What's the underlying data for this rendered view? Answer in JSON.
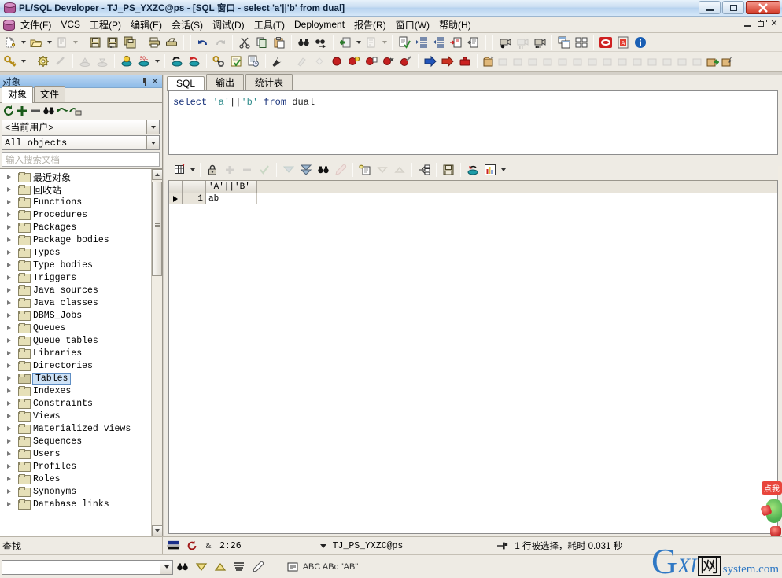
{
  "window": {
    "title": "PL/SQL Developer - TJ_PS_YXZC@ps - [SQL 窗口 - select 'a'||'b' from dual]",
    "app_icon": "database-icon",
    "buttons": {
      "minimize": "minimize-icon",
      "maximize": "maximize-icon",
      "close": "close-icon"
    },
    "mdi_buttons": {
      "minimize": "mdi-minimize-icon",
      "restore": "mdi-restore-icon",
      "close": "mdi-close-icon"
    }
  },
  "menu": {
    "icon": "database-icon",
    "items": [
      {
        "label": "文件(F)",
        "name": "menu-file"
      },
      {
        "label": "VCS",
        "name": "menu-vcs"
      },
      {
        "label": "工程(P)",
        "name": "menu-project"
      },
      {
        "label": "编辑(E)",
        "name": "menu-edit"
      },
      {
        "label": "会话(S)",
        "name": "menu-session"
      },
      {
        "label": "调试(D)",
        "name": "menu-debug"
      },
      {
        "label": "工具(T)",
        "name": "menu-tools"
      },
      {
        "label": "Deployment",
        "name": "menu-deployment"
      },
      {
        "label": "报告(R)",
        "name": "menu-reports"
      },
      {
        "label": "窗口(W)",
        "name": "menu-window"
      },
      {
        "label": "帮助(H)",
        "name": "menu-help"
      }
    ]
  },
  "toolbar_main": {
    "groups": [
      {
        "buttons": [
          {
            "name": "new-icon",
            "glyph": "new",
            "enabled": true,
            "dropdown": true
          },
          {
            "name": "open-icon",
            "glyph": "open",
            "enabled": true,
            "dropdown": true
          },
          {
            "name": "print-preview-icon",
            "glyph": "printpreview",
            "enabled": false,
            "dropdown": true
          }
        ]
      },
      {
        "buttons": [
          {
            "name": "save-icon",
            "glyph": "save",
            "enabled": true
          },
          {
            "name": "save-as-icon",
            "glyph": "saveas",
            "enabled": true
          },
          {
            "name": "save-all-icon",
            "glyph": "saveall",
            "enabled": true
          }
        ]
      },
      {
        "buttons": [
          {
            "name": "print-icon",
            "glyph": "print",
            "enabled": true
          },
          {
            "name": "print-setup-icon",
            "glyph": "printsetup",
            "enabled": true
          }
        ]
      },
      {
        "buttons": [
          {
            "name": "undo-icon",
            "glyph": "undo",
            "enabled": true
          },
          {
            "name": "redo-icon",
            "glyph": "redo",
            "enabled": false
          }
        ]
      },
      {
        "buttons": [
          {
            "name": "cut-icon",
            "glyph": "cut",
            "enabled": true
          },
          {
            "name": "copy-icon",
            "glyph": "copy",
            "enabled": true
          },
          {
            "name": "paste-icon",
            "glyph": "paste",
            "enabled": true
          }
        ]
      },
      {
        "buttons": [
          {
            "name": "find-icon",
            "glyph": "find",
            "enabled": true
          },
          {
            "name": "find-next-icon",
            "glyph": "findnext",
            "enabled": true
          }
        ]
      },
      {
        "buttons": [
          {
            "name": "back-icon",
            "glyph": "back",
            "enabled": true,
            "dropdown": true
          },
          {
            "name": "forward-icon",
            "glyph": "forward",
            "enabled": false,
            "dropdown": true
          }
        ]
      },
      {
        "buttons": [
          {
            "name": "syntax-check-icon",
            "glyph": "syntaxcheck",
            "enabled": true
          },
          {
            "name": "indent-icon",
            "glyph": "indent",
            "enabled": true
          },
          {
            "name": "outdent-icon",
            "glyph": "outdent",
            "enabled": true
          },
          {
            "name": "insert-template-icon",
            "glyph": "inserttpl",
            "enabled": true
          },
          {
            "name": "comment-icon",
            "glyph": "comment",
            "enabled": true
          }
        ]
      },
      {
        "buttons": [
          {
            "name": "record-macro-icon",
            "glyph": "recmacro",
            "enabled": true
          },
          {
            "name": "pause-macro-icon",
            "glyph": "pausemacro",
            "enabled": false
          },
          {
            "name": "play-macro-icon",
            "glyph": "playmacro",
            "enabled": true
          }
        ]
      },
      {
        "buttons": [
          {
            "name": "tile-windows-icon",
            "glyph": "tile",
            "enabled": true
          },
          {
            "name": "cascade-windows-icon",
            "glyph": "cascade",
            "enabled": true
          }
        ]
      },
      {
        "buttons": [
          {
            "name": "oracle-icon",
            "glyph": "oracle",
            "enabled": true
          },
          {
            "name": "pdf-icon",
            "glyph": "pdf",
            "enabled": true
          },
          {
            "name": "about-icon",
            "glyph": "about",
            "enabled": true
          }
        ]
      }
    ]
  },
  "toolbar_session": {
    "groups": [
      {
        "buttons": [
          {
            "name": "logon-icon",
            "glyph": "key",
            "enabled": true,
            "dropdown": true
          }
        ]
      },
      {
        "buttons": [
          {
            "name": "session-settings-icon",
            "glyph": "gear",
            "enabled": true
          },
          {
            "name": "break-icon",
            "glyph": "break",
            "enabled": false
          }
        ]
      },
      {
        "buttons": [
          {
            "name": "import-icon",
            "glyph": "import",
            "enabled": false
          },
          {
            "name": "export-icon",
            "glyph": "export",
            "enabled": false
          }
        ]
      },
      {
        "buttons": [
          {
            "name": "execute-icon",
            "glyph": "execute",
            "enabled": true
          },
          {
            "name": "execute-sql-icon",
            "glyph": "executesql",
            "enabled": true,
            "dropdown": true
          }
        ]
      },
      {
        "buttons": [
          {
            "name": "commit-icon",
            "glyph": "commit",
            "enabled": true
          },
          {
            "name": "rollback-icon",
            "glyph": "rollback",
            "enabled": true
          }
        ]
      },
      {
        "buttons": [
          {
            "name": "explain-plan-icon",
            "glyph": "explain",
            "enabled": true
          },
          {
            "name": "test-window-icon",
            "glyph": "testwin",
            "enabled": true
          },
          {
            "name": "report-window-icon",
            "glyph": "reportwin",
            "enabled": true
          }
        ]
      },
      {
        "buttons": [
          {
            "name": "preferences-icon",
            "glyph": "wrench",
            "enabled": true
          }
        ]
      },
      {
        "buttons": [
          {
            "name": "compile-icon",
            "glyph": "compile",
            "enabled": false
          },
          {
            "name": "compile-invalid-icon",
            "glyph": "compileinv",
            "enabled": false
          }
        ]
      },
      {
        "buttons": [
          {
            "name": "breakpoint-icon",
            "glyph": "bp",
            "enabled": true
          },
          {
            "name": "toggle-breakpoint-icon",
            "glyph": "bptoggle",
            "enabled": true
          },
          {
            "name": "add-breakpoint-icon",
            "glyph": "bpadd",
            "enabled": true
          },
          {
            "name": "remove-breakpoint-icon",
            "glyph": "bpdel",
            "enabled": true
          },
          {
            "name": "clear-breakpoints-icon",
            "glyph": "bpclear",
            "enabled": true
          }
        ]
      },
      {
        "buttons": [
          {
            "name": "step-into-icon",
            "glyph": "stepin",
            "enabled": true
          },
          {
            "name": "step-over-icon",
            "glyph": "stepover",
            "enabled": true
          },
          {
            "name": "step-out-icon",
            "glyph": "stepout",
            "enabled": true
          }
        ]
      },
      {
        "buttons": [
          {
            "name": "new-object-icon",
            "glyph": "objnew",
            "enabled": true
          },
          {
            "name": "obj-2-icon",
            "glyph": "obj",
            "enabled": false
          },
          {
            "name": "obj-3-icon",
            "glyph": "obj",
            "enabled": false
          },
          {
            "name": "obj-4-icon",
            "glyph": "obj",
            "enabled": false
          },
          {
            "name": "obj-5-icon",
            "glyph": "obj",
            "enabled": false
          },
          {
            "name": "obj-6-icon",
            "glyph": "obj",
            "enabled": false
          },
          {
            "name": "obj-7-icon",
            "glyph": "obj",
            "enabled": false
          },
          {
            "name": "obj-8-icon",
            "glyph": "obj",
            "enabled": false
          },
          {
            "name": "obj-9-icon",
            "glyph": "obj",
            "enabled": false
          },
          {
            "name": "obj-10-icon",
            "glyph": "obj",
            "enabled": false
          },
          {
            "name": "obj-11-icon",
            "glyph": "obj",
            "enabled": false
          },
          {
            "name": "obj-12-icon",
            "glyph": "obj",
            "enabled": false
          },
          {
            "name": "obj-13-icon",
            "glyph": "obj",
            "enabled": false
          },
          {
            "name": "obj-14-icon",
            "glyph": "obj",
            "enabled": false
          },
          {
            "name": "obj-15-icon",
            "glyph": "obj",
            "enabled": false
          },
          {
            "name": "obj-16-icon",
            "glyph": "objgo",
            "enabled": true
          },
          {
            "name": "obj-17-icon",
            "glyph": "objwrench",
            "enabled": true
          }
        ]
      }
    ]
  },
  "object_panel": {
    "caption": "对象",
    "pin_icon": "pin-icon",
    "close_icon": "close-icon",
    "tabs": [
      {
        "label": "对象",
        "active": true
      },
      {
        "label": "文件",
        "active": false
      }
    ],
    "toolbar": [
      {
        "name": "refresh-icon"
      },
      {
        "name": "expand-icon"
      },
      {
        "name": "collapse-icon"
      },
      {
        "name": "find-object-icon"
      },
      {
        "name": "filter-icon"
      },
      {
        "name": "filter-lock-icon"
      }
    ],
    "user_combo": {
      "value": "<当前用户>",
      "name": "user-select"
    },
    "filter_combo": {
      "value": "All objects",
      "name": "object-filter-select"
    },
    "search_placeholder": "输入搜索文档",
    "tree": [
      {
        "label": "最近对象",
        "cn": true,
        "selected": false
      },
      {
        "label": "回收站",
        "cn": true,
        "selected": false
      },
      {
        "label": "Functions",
        "cn": false,
        "selected": false
      },
      {
        "label": "Procedures",
        "cn": false,
        "selected": false
      },
      {
        "label": "Packages",
        "cn": false,
        "selected": false
      },
      {
        "label": "Package bodies",
        "cn": false,
        "selected": false
      },
      {
        "label": "Types",
        "cn": false,
        "selected": false
      },
      {
        "label": "Type bodies",
        "cn": false,
        "selected": false
      },
      {
        "label": "Triggers",
        "cn": false,
        "selected": false
      },
      {
        "label": "Java sources",
        "cn": false,
        "selected": false
      },
      {
        "label": "Java classes",
        "cn": false,
        "selected": false
      },
      {
        "label": "DBMS_Jobs",
        "cn": false,
        "selected": false
      },
      {
        "label": "Queues",
        "cn": false,
        "selected": false
      },
      {
        "label": "Queue tables",
        "cn": false,
        "selected": false
      },
      {
        "label": "Libraries",
        "cn": false,
        "selected": false
      },
      {
        "label": "Directories",
        "cn": false,
        "selected": false
      },
      {
        "label": "Tables",
        "cn": false,
        "selected": true
      },
      {
        "label": "Indexes",
        "cn": false,
        "selected": false
      },
      {
        "label": "Constraints",
        "cn": false,
        "selected": false
      },
      {
        "label": "Views",
        "cn": false,
        "selected": false
      },
      {
        "label": "Materialized views",
        "cn": false,
        "selected": false
      },
      {
        "label": "Sequences",
        "cn": false,
        "selected": false
      },
      {
        "label": "Users",
        "cn": false,
        "selected": false
      },
      {
        "label": "Profiles",
        "cn": false,
        "selected": false
      },
      {
        "label": "Roles",
        "cn": false,
        "selected": false
      },
      {
        "label": "Synonyms",
        "cn": false,
        "selected": false
      },
      {
        "label": "Database links",
        "cn": false,
        "selected": false
      }
    ]
  },
  "editor": {
    "tabs": [
      {
        "label": "SQL",
        "active": true
      },
      {
        "label": "输出",
        "active": false
      },
      {
        "label": "统计表",
        "active": false
      }
    ],
    "sql": {
      "tokens": [
        {
          "text": "select",
          "type": "keyword"
        },
        {
          "text": " ",
          "type": "plain"
        },
        {
          "text": "'a'",
          "type": "string"
        },
        {
          "text": "||",
          "type": "operator"
        },
        {
          "text": "'b'",
          "type": "string"
        },
        {
          "text": " ",
          "type": "plain"
        },
        {
          "text": "from",
          "type": "keyword"
        },
        {
          "text": " dual",
          "type": "plain"
        }
      ],
      "full_text": "select 'a'||'b' from dual"
    },
    "colors": {
      "keyword": "#17317a",
      "string": "#2e8b8b",
      "plain": "#222222"
    }
  },
  "result_toolbar": {
    "buttons": [
      {
        "name": "grid-layout-icon",
        "enabled": true,
        "dropdown": true
      },
      {
        "name": "lock-icon",
        "enabled": true
      },
      {
        "name": "insert-row-icon",
        "enabled": false
      },
      {
        "name": "delete-row-icon",
        "enabled": false
      },
      {
        "name": "post-changes-icon",
        "enabled": false
      },
      {
        "name": "fetch-next-page-icon",
        "enabled": false
      },
      {
        "name": "fetch-last-page-icon",
        "enabled": true
      },
      {
        "name": "find-in-grid-icon",
        "enabled": true
      },
      {
        "name": "clear-filter-icon",
        "enabled": false
      },
      {
        "name": "copy-to-clipboard-icon",
        "enabled": true
      },
      {
        "name": "sort-descending-icon",
        "enabled": false
      },
      {
        "name": "sort-ascending-icon",
        "enabled": false
      },
      {
        "name": "single-record-view-icon",
        "enabled": true
      },
      {
        "name": "export-results-icon",
        "enabled": true
      },
      {
        "name": "commit-results-icon",
        "enabled": true
      },
      {
        "name": "chart-icon",
        "enabled": true,
        "dropdown": true
      }
    ]
  },
  "result_grid": {
    "columns": [
      "'A'||'B'"
    ],
    "rows": [
      {
        "num": "1",
        "current": true,
        "cells": [
          "ab"
        ]
      }
    ]
  },
  "statusbar": {
    "mode_icon": "insert-mode-icon",
    "refresh_icon": "refresh-icon",
    "lock_icon": "session-icon",
    "cursor_position": "2:26",
    "connection_dropdown_icon": "chevron-down-icon",
    "connection": "TJ_PS_YXZC@ps",
    "result_icon": "pin-result-icon",
    "result_text": "1 行被选择，耗时 0.031 秒"
  },
  "findbar": {
    "caption": "查找",
    "input_value": "",
    "buttons": [
      {
        "name": "find-icon",
        "label": ""
      },
      {
        "name": "find-down-icon",
        "label": ""
      },
      {
        "name": "find-up-icon",
        "label": ""
      },
      {
        "name": "find-all-icon",
        "label": ""
      },
      {
        "name": "clear-highlight-icon",
        "label": ""
      },
      {
        "name": "find-in-selection-icon",
        "label": ""
      },
      {
        "name": "match-case-icon",
        "label": "ABC"
      },
      {
        "name": "whole-word-icon",
        "label": "ABc"
      },
      {
        "name": "regex-icon",
        "label": "\"AB\""
      }
    ]
  },
  "watermark": {
    "g": "G",
    "xi": "XI",
    "wang": "网",
    "sub": "system.com"
  },
  "float_widget": {
    "bubble_text": "点我"
  },
  "colors": {
    "titlebar_start": "#e8f2fb",
    "titlebar_end": "#b6d2ee",
    "panel_bg": "#eeebe4",
    "selection": "#cfe3f7",
    "accent_blue": "#2f78c4",
    "close_red": "#d33b28"
  }
}
